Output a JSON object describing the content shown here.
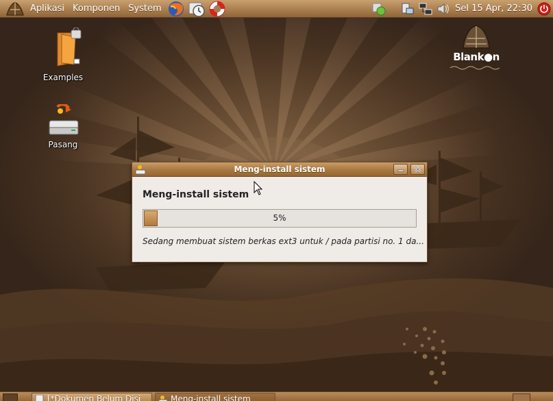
{
  "top_panel": {
    "menus": [
      "Aplikasi",
      "Komponen",
      "System"
    ],
    "clock": "Sel 15 Apr, 22:30",
    "launchers": [
      "firefox-icon",
      "clock-settings-icon",
      "help-lifebuoy-icon"
    ],
    "tray_icons": [
      "update-notifier-icon",
      "network-manager-icon",
      "network-icon",
      "volume-icon"
    ]
  },
  "desktop": {
    "icons": [
      {
        "label": "Examples",
        "icon": "locked-folder-icon"
      },
      {
        "label": "Pasang",
        "icon": "install-drive-icon"
      }
    ],
    "brand": "Blank●n"
  },
  "dialog": {
    "title": "Meng-install sistem",
    "heading": "Meng-install sistem",
    "progress": {
      "value": 5,
      "label": "5%"
    },
    "status": "Sedang membuat sistem berkas ext3 untuk / pada partisi no. 1 da..."
  },
  "taskbar": {
    "tasks": [
      {
        "label": "[*Dokumen Belum Disi",
        "active": false
      },
      {
        "label": "Meng-install sistem",
        "active": true
      }
    ]
  },
  "colors": {
    "panel": "#a87c4c",
    "desktop_sun": "#8a6a4a",
    "desktop_dark": "#35251a",
    "dialog_bg": "#efebe7",
    "progress_fill": "#c89258"
  }
}
